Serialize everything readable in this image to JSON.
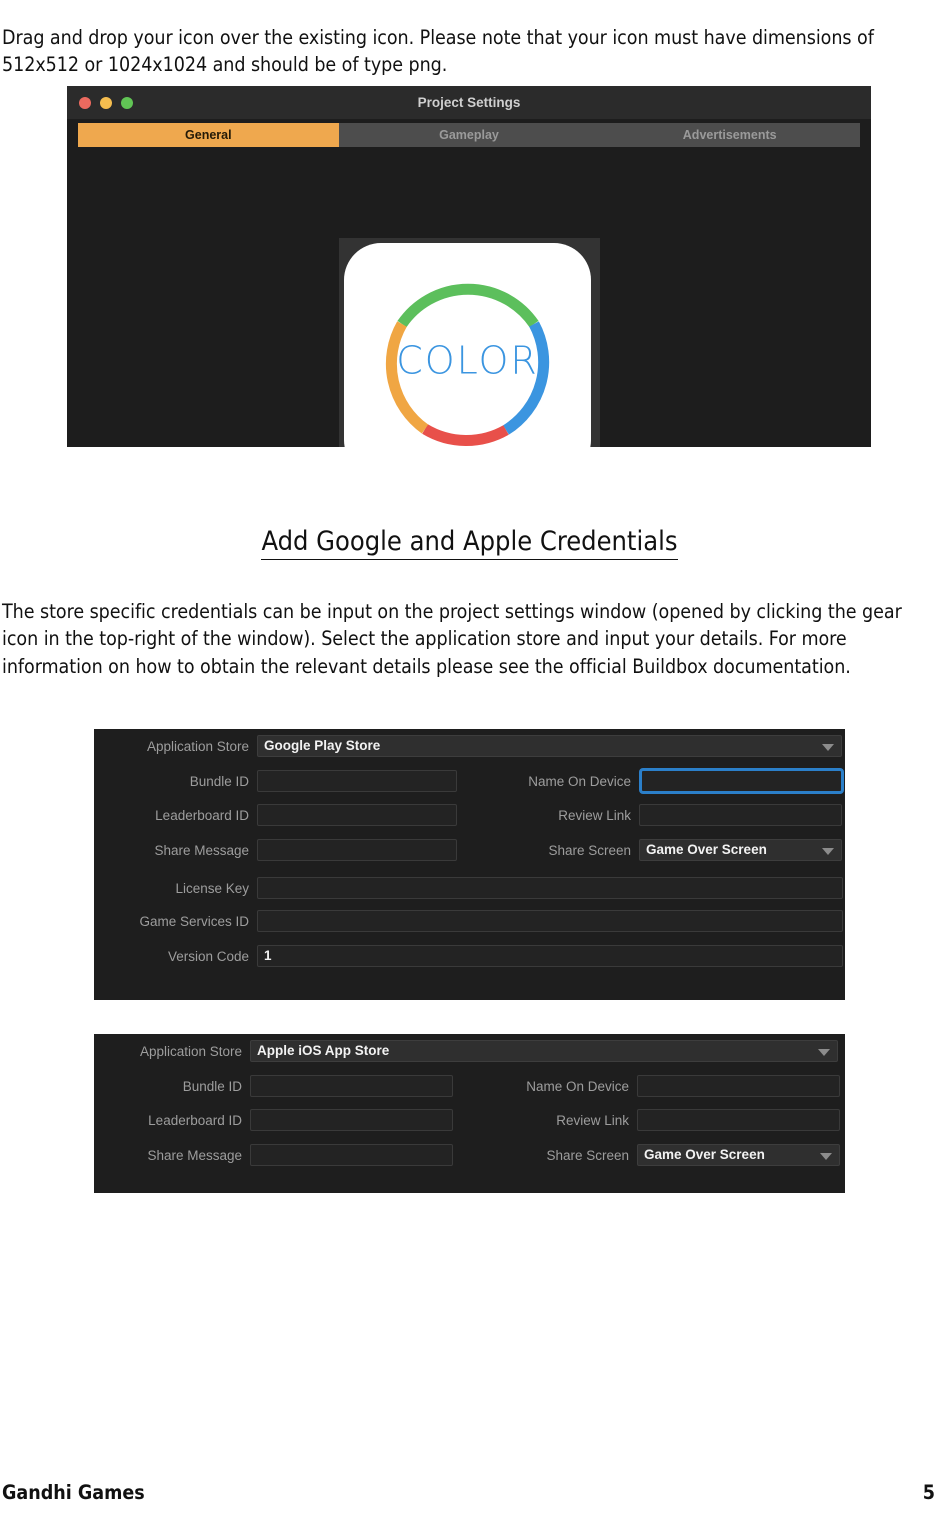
{
  "document": {
    "intro_paragraph": "Drag and drop your icon over the existing icon. Please note that your icon must have dimensions of 512x512 or 1024x1024 and should be of type png.",
    "section_heading": "Add Google and Apple Credentials",
    "credentials_paragraph": "The store specific credentials can be input on the project settings window (opened by clicking the gear icon in the top-right of the window). Select the application store and input your details. For more information on how to obtain the relevant details please see the official Buildbox documentation.",
    "footer_left": "Gandhi Games",
    "footer_page_number": "5"
  },
  "project_settings_window": {
    "title": "Project Settings",
    "traffic_lights": [
      {
        "name": "close",
        "color": "#ec6a5f"
      },
      {
        "name": "minimize",
        "color": "#f5bd4f"
      },
      {
        "name": "zoom",
        "color": "#61c555"
      }
    ],
    "tabs": [
      {
        "label": "General",
        "active": true
      },
      {
        "label": "Gameplay",
        "active": false
      },
      {
        "label": "Advertisements",
        "active": false
      }
    ],
    "active_tab_color": "#efa84e",
    "app_icon": {
      "text": "COLOR",
      "text_color": "#3b95e0",
      "ring_colors": {
        "top": "#5cbf5c",
        "right": "#3b95e0",
        "bottom": "#e8504a",
        "left": "#f0a643"
      }
    }
  },
  "google_store_panel": {
    "application_store_label": "Application Store",
    "application_store_value": "Google Play Store",
    "fields_left": [
      {
        "label": "Bundle ID",
        "value": "",
        "type": "text",
        "focused": false
      },
      {
        "label": "Leaderboard ID",
        "value": "",
        "type": "text",
        "focused": false
      },
      {
        "label": "Share Message",
        "value": "",
        "type": "text",
        "focused": false
      }
    ],
    "fields_right": [
      {
        "label": "Name On Device",
        "value": "",
        "type": "text",
        "focused": true
      },
      {
        "label": "Review Link",
        "value": "",
        "type": "text",
        "focused": false
      },
      {
        "label": "Share Screen",
        "value": "Game Over Screen",
        "type": "select",
        "focused": false
      }
    ],
    "fields_wide": [
      {
        "label": "License Key",
        "value": "",
        "type": "text"
      },
      {
        "label": "Game Services ID",
        "value": "",
        "type": "text"
      },
      {
        "label": "Version Code",
        "value": "1",
        "type": "text"
      }
    ]
  },
  "apple_store_panel": {
    "application_store_label": "Application Store",
    "application_store_value": "Apple iOS App Store",
    "fields_left": [
      {
        "label": "Bundle ID",
        "value": "",
        "type": "text"
      },
      {
        "label": "Leaderboard ID",
        "value": "",
        "type": "text"
      },
      {
        "label": "Share Message",
        "value": "",
        "type": "text"
      }
    ],
    "fields_right": [
      {
        "label": "Name On Device",
        "value": "",
        "type": "text"
      },
      {
        "label": "Review Link",
        "value": "",
        "type": "text"
      },
      {
        "label": "Share Screen",
        "value": "Game Over Screen",
        "type": "select"
      }
    ]
  }
}
